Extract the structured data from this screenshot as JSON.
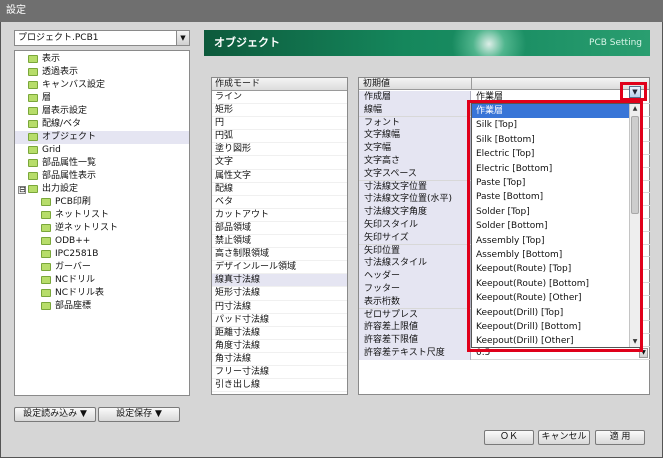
{
  "window": {
    "title": "設定"
  },
  "project_selector": {
    "value": "プロジェクト.PCB1"
  },
  "tree": {
    "items": [
      {
        "label": "表示",
        "level": 1
      },
      {
        "label": "透過表示",
        "level": 1
      },
      {
        "label": "キャンバス設定",
        "level": 1
      },
      {
        "label": "層",
        "level": 1
      },
      {
        "label": "層表示設定",
        "level": 1
      },
      {
        "label": "配線/ベタ",
        "level": 1
      },
      {
        "label": "オブジェクト",
        "level": 1,
        "selected": true
      },
      {
        "label": "Grid",
        "level": 1
      },
      {
        "label": "部品属性一覧",
        "level": 1
      },
      {
        "label": "部品属性表示",
        "level": 1
      },
      {
        "label": "出力設定",
        "level": 1,
        "expander": "⊟"
      },
      {
        "label": "PCB印刷",
        "level": 2
      },
      {
        "label": "ネットリスト",
        "level": 2
      },
      {
        "label": "逆ネットリスト",
        "level": 2
      },
      {
        "label": "ODB++",
        "level": 2
      },
      {
        "label": "IPC2581B",
        "level": 2
      },
      {
        "label": "ガーバー",
        "level": 2
      },
      {
        "label": "NCドリル",
        "level": 2
      },
      {
        "label": "NCドリル表",
        "level": 2
      },
      {
        "label": "部品座標",
        "level": 2
      }
    ]
  },
  "buttons": {
    "load_settings": "設定読み込み ▼",
    "save_settings": "設定保存 ▼",
    "ok": "ＯＫ",
    "cancel": "キャンセル",
    "apply": "適 用"
  },
  "banner": {
    "title": "オブジェクト",
    "subtitle": "PCB Setting"
  },
  "mode_list": {
    "header": "作成モード",
    "items": [
      "ライン",
      "矩形",
      "円",
      "円弧",
      "塗り図形",
      "文字",
      "属性文字",
      "配線",
      "ベタ",
      "カットアウト",
      "部品領域",
      "禁止領域",
      "高さ制限領域",
      "デザインルール領域",
      "線真寸法線",
      "矩形寸法線",
      "円寸法線",
      "パッド寸法線",
      "距離寸法線",
      "角度寸法線",
      "角寸法線",
      "フリー寸法線",
      "引き出し線"
    ],
    "selected_index": 14
  },
  "property_grid": {
    "header": "初期値",
    "rows": [
      {
        "name": "作成層",
        "value": "作業層"
      },
      {
        "name": "線幅",
        "value": ""
      },
      {
        "name": "フォント",
        "value": ""
      },
      {
        "name": "文字線幅",
        "value": ""
      },
      {
        "name": "文字幅",
        "value": ""
      },
      {
        "name": "文字高さ",
        "value": ""
      },
      {
        "name": "文字スペース",
        "value": ""
      },
      {
        "name": "寸法線文字位置",
        "value": ""
      },
      {
        "name": "寸法線文字位置(水平)",
        "value": ""
      },
      {
        "name": "寸法線文字角度",
        "value": ""
      },
      {
        "name": "矢印スタイル",
        "value": ""
      },
      {
        "name": "矢印サイズ",
        "value": ""
      },
      {
        "name": "矢印位置",
        "value": ""
      },
      {
        "name": "寸法線スタイル",
        "value": ""
      },
      {
        "name": "ヘッダー",
        "value": ""
      },
      {
        "name": "フッター",
        "value": ""
      },
      {
        "name": "表示桁数",
        "value": ""
      },
      {
        "name": "ゼロサプレス",
        "value": ""
      },
      {
        "name": "許容差上限値",
        "value": ""
      },
      {
        "name": "許容差下限値",
        "value": ""
      },
      {
        "name": "許容差テキスト尺度",
        "value": "0.5"
      }
    ]
  },
  "layer_dropdown": {
    "options": [
      "作業層",
      "Silk [Top]",
      "Silk [Bottom]",
      "Electric [Top]",
      "Electric [Bottom]",
      "Paste [Top]",
      "Paste [Bottom]",
      "Solder [Top]",
      "Solder [Bottom]",
      "Assembly [Top]",
      "Assembly [Bottom]",
      "Keepout(Route) [Top]",
      "Keepout(Route) [Bottom]",
      "Keepout(Route) [Other]",
      "Keepout(Drill) [Top]",
      "Keepout(Drill) [Bottom]",
      "Keepout(Drill) [Other]"
    ],
    "selected_index": 0
  },
  "colors": {
    "highlight": "#e0001a",
    "selection": "#3875d7",
    "banner": "#15875c"
  }
}
